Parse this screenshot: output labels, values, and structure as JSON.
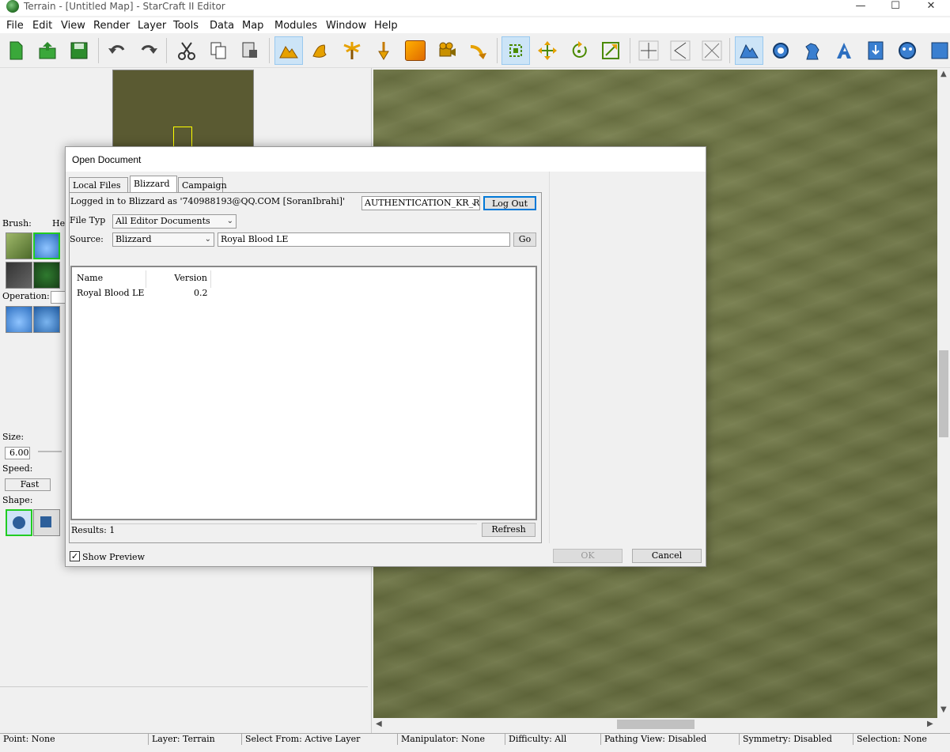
{
  "window": {
    "title": "Terrain - [Untitled Map] - StarCraft II Editor",
    "minimize": "—",
    "maximize": "☐",
    "close": "✕"
  },
  "menu": [
    "File",
    "Edit",
    "View",
    "Render",
    "Layer",
    "Tools",
    "Data",
    "Map",
    "Modules",
    "Window",
    "Help"
  ],
  "toolbar": {
    "icons": [
      "new-document-icon",
      "open-document-icon",
      "save-icon",
      "undo-icon",
      "redo-icon",
      "cut-icon",
      "copy-icon",
      "paste-icon",
      "terrain-layer-icon",
      "units-layer-icon",
      "doodads-layer-icon",
      "points-layer-icon",
      "regions-layer-icon",
      "cameras-layer-icon",
      "paths-layer-icon",
      "select-icon",
      "move-icon",
      "rotate-icon",
      "scale-icon",
      "snap-icon",
      "snap-edge-icon",
      "snap-center-icon",
      "terrain-module-icon",
      "triggers-module-icon",
      "data-module-icon",
      "text-module-icon",
      "import-module-icon",
      "ai-module-icon"
    ]
  },
  "left_panel": {
    "brush_label": "Brush:",
    "height_label": "Hei",
    "operation_label": "Operation:",
    "size_label": "Size:",
    "size_value": "6.00",
    "speed_label": "Speed:",
    "speed_value": "Fast",
    "shape_label": "Shape:"
  },
  "dialog": {
    "title": "Open Document",
    "tabs": [
      "Local Files",
      "Blizzard",
      "Campaign"
    ],
    "selected_tab": "Blizzard",
    "logged_in_text": "Logged in to Blizzard as '740988193@QQ.COM [SoranIbrahi]'",
    "region": "AUTHENTICATION_KR_REG",
    "logout_label": "Log Out",
    "file_type_label": "File Typ",
    "file_type_value": "All Editor Documents",
    "source_label": "Source:",
    "source_value": "Blizzard",
    "search_value": "Royal Blood LE",
    "go_label": "Go",
    "columns": [
      "Name",
      "Version"
    ],
    "rows": [
      {
        "name": "Royal Blood LE",
        "version": "0.2"
      }
    ],
    "results_text": "Results: 1",
    "refresh_label": "Refresh",
    "show_preview_label": "Show Preview",
    "show_preview_checked": true,
    "ok_label": "OK",
    "cancel_label": "Cancel"
  },
  "status": {
    "point": "Point: None",
    "layer": "Layer: Terrain",
    "select_from": "Select From: Active Layer",
    "manipulator": "Manipulator: None",
    "difficulty": "Difficulty: All",
    "pathing_view": "Pathing View: Disabled",
    "symmetry": "Symmetry: Disabled",
    "selection": "Selection: None"
  },
  "colors": {
    "terrain": "#6f7743",
    "active_toolbar": "#cce4f7",
    "focus_border": "#0078d7",
    "minimap": "#5a5a32"
  }
}
